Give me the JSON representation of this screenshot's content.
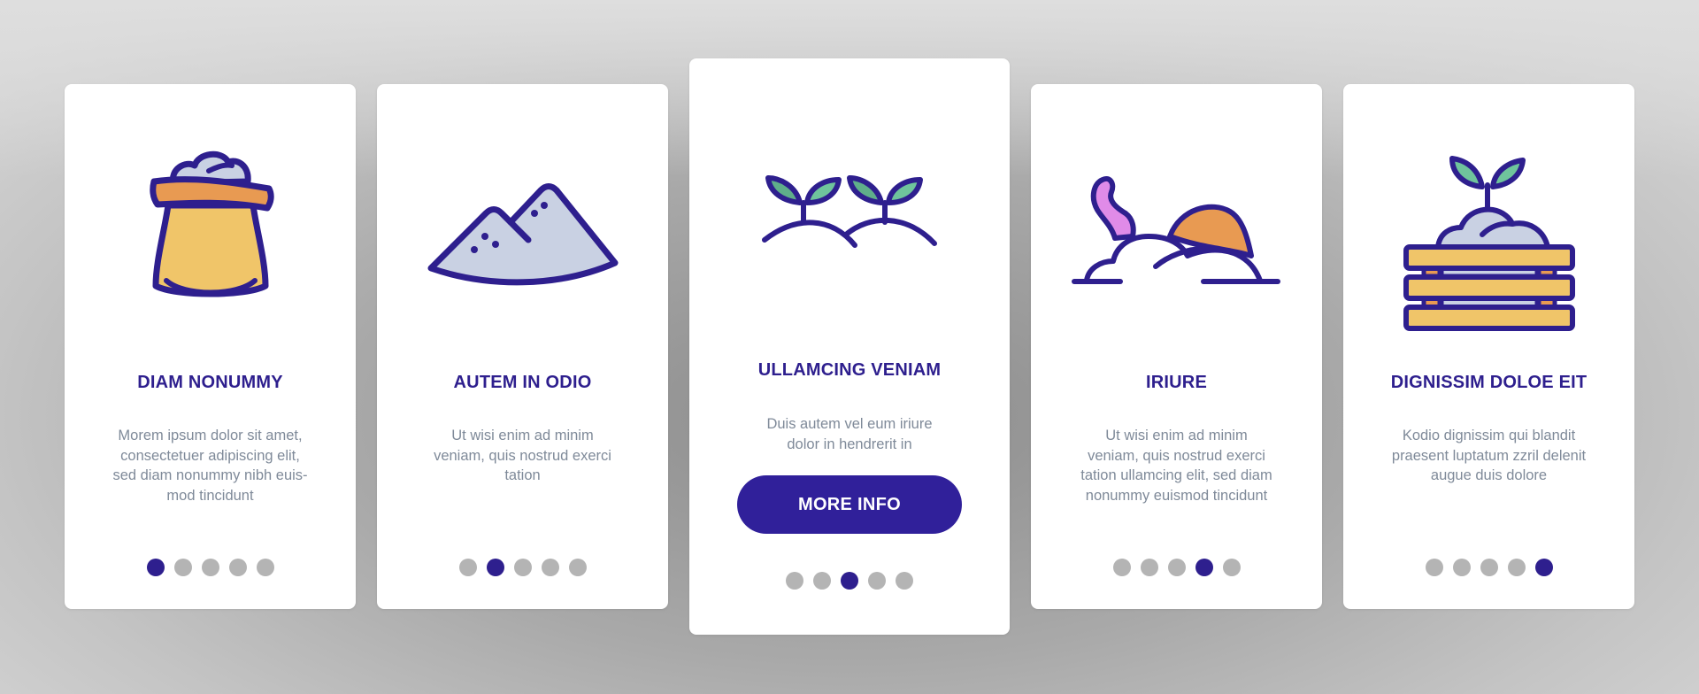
{
  "colors": {
    "accent": "#2e1f8e",
    "button": "#30209a",
    "dot_inactive": "#b4b4b4",
    "description_text": "#7f8a99",
    "sack_body": "#f0c569",
    "sack_rim": "#e89a52",
    "powder": "#c9d1e3",
    "leaf": "#6fc49c",
    "worm": "#e08be8",
    "card_bg": "#ffffff"
  },
  "cards": [
    {
      "icon": "flour-sack-icon",
      "title": "DIAM NONUMMY",
      "description": "Morem ipsum dolor sit amet, consectetuer adipiscing elit, sed diam nonummy nibh euis-mod tincidunt",
      "description_lines": [
        "Morem ipsum dolor sit amet,",
        "consectetuer adipiscing elit,",
        "sed diam nonummy nibh euis-",
        "mod tincidunt"
      ],
      "active_dot": 1
    },
    {
      "icon": "soil-pile-icon",
      "title": "AUTEM IN ODIO",
      "description": "Ut wisi enim ad minim veniam, quis nostrud exerci tation",
      "description_lines": [
        "Ut wisi enim ad minim",
        "veniam, quis nostrud exerci",
        "tation"
      ],
      "active_dot": 2
    },
    {
      "icon": "sprouts-icon",
      "title": "ULLAMCING VENIAM",
      "description": "Duis autem vel eum iriure dolor in hendrerit in",
      "description_lines": [
        "Duis autem vel eum iriure",
        "dolor in hendrerit in"
      ],
      "button_label": "MORE INFO",
      "active_dot": 3
    },
    {
      "icon": "worm-in-soil-icon",
      "title": "IRIURE",
      "description": "Ut wisi enim ad minim veniam, quis nostrud exerci tation ullamcing elit, sed diam nonummy euismod tincidunt",
      "description_lines": [
        "Ut wisi enim ad minim",
        "veniam, quis nostrud exerci",
        "tation ullamcing elit, sed diam",
        "nonummy euismod tincidunt"
      ],
      "active_dot": 4
    },
    {
      "icon": "seedling-crate-icon",
      "title": "DIGNISSIM DOLOE EIT",
      "description": "Kodio dignissim qui blandit praesent luptatum zzril delenit augue duis dolore",
      "description_lines": [
        "Kodio dignissim qui blandit",
        "praesent luptatum zzril delenit",
        "augue duis dolore"
      ],
      "active_dot": 5
    }
  ],
  "pagination": {
    "total_pages": 5
  }
}
